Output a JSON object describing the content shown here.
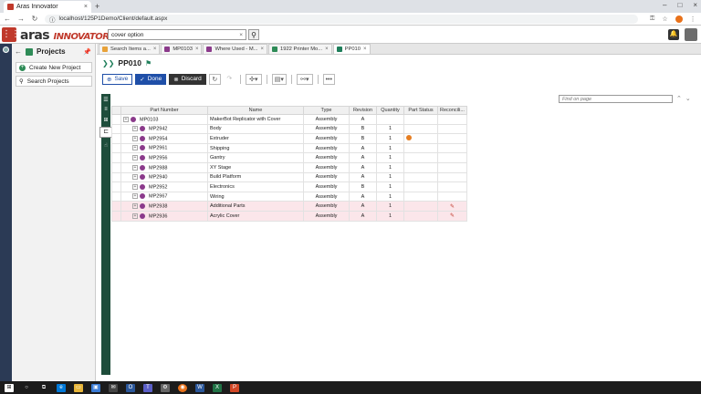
{
  "browser": {
    "tab_title": "Aras Innovator",
    "url": "localhost/125P1Demo/Client/default.aspx"
  },
  "header": {
    "logo_main": "aras",
    "logo_sub": "INNOVATOR",
    "search_value": "cover option"
  },
  "sidebar": {
    "title": "Projects",
    "items": [
      {
        "label": "Create New Project"
      },
      {
        "label": "Search Projects"
      }
    ]
  },
  "doc_tabs": [
    {
      "label": "Search Items a...",
      "color": "#e8a23a"
    },
    {
      "label": "MP0103",
      "color": "#8b3a8b"
    },
    {
      "label": "Where Used - M...",
      "color": "#8b3a8b"
    },
    {
      "label": "1922 Printer Mo...",
      "color": "#2e8b57"
    },
    {
      "label": "PP010",
      "color": "#1e7e5a"
    }
  ],
  "item": {
    "title": "PP010"
  },
  "toolbar": {
    "save_label": "Save",
    "done_label": "Done",
    "discard_label": "Discard"
  },
  "find": {
    "placeholder": "Find on page"
  },
  "grid": {
    "headers": [
      "Part Number",
      "Name",
      "Type",
      "Revision",
      "Quantity",
      "Part Status",
      "Reconcili..."
    ],
    "rows": [
      {
        "part": "MP0103",
        "name": "MakerBot Replicator with Cover",
        "type": "Assembly",
        "rev": "A",
        "qty": "",
        "status": false,
        "reconcile": false,
        "highlight": false,
        "root": true
      },
      {
        "part": "MP2942",
        "name": "Body",
        "type": "Assembly",
        "rev": "B",
        "qty": "1",
        "status": false,
        "reconcile": false,
        "highlight": false,
        "root": false
      },
      {
        "part": "MP2954",
        "name": "Extruder",
        "type": "Assembly",
        "rev": "B",
        "qty": "1",
        "status": true,
        "reconcile": false,
        "highlight": false,
        "root": false
      },
      {
        "part": "MP2961",
        "name": "Shipping",
        "type": "Assembly",
        "rev": "A",
        "qty": "1",
        "status": false,
        "reconcile": false,
        "highlight": false,
        "root": false
      },
      {
        "part": "MP2956",
        "name": "Gantry",
        "type": "Assembly",
        "rev": "A",
        "qty": "1",
        "status": false,
        "reconcile": false,
        "highlight": false,
        "root": false
      },
      {
        "part": "MP2988",
        "name": "XY Stage",
        "type": "Assembly",
        "rev": "A",
        "qty": "1",
        "status": false,
        "reconcile": false,
        "highlight": false,
        "root": false
      },
      {
        "part": "MP2940",
        "name": "Build Platform",
        "type": "Assembly",
        "rev": "A",
        "qty": "1",
        "status": false,
        "reconcile": false,
        "highlight": false,
        "root": false
      },
      {
        "part": "MP2952",
        "name": "Electronics",
        "type": "Assembly",
        "rev": "B",
        "qty": "1",
        "status": false,
        "reconcile": false,
        "highlight": false,
        "root": false
      },
      {
        "part": "MP2967",
        "name": "Wiring",
        "type": "Assembly",
        "rev": "A",
        "qty": "1",
        "status": false,
        "reconcile": false,
        "highlight": false,
        "root": false
      },
      {
        "part": "MP2938",
        "name": "Additional Parts",
        "type": "Assembly",
        "rev": "A",
        "qty": "1",
        "status": false,
        "reconcile": true,
        "highlight": true,
        "root": false
      },
      {
        "part": "MP2936",
        "name": "Acrylic Cover",
        "type": "Assembly",
        "rev": "A",
        "qty": "1",
        "status": false,
        "reconcile": true,
        "highlight": true,
        "root": false
      }
    ]
  }
}
